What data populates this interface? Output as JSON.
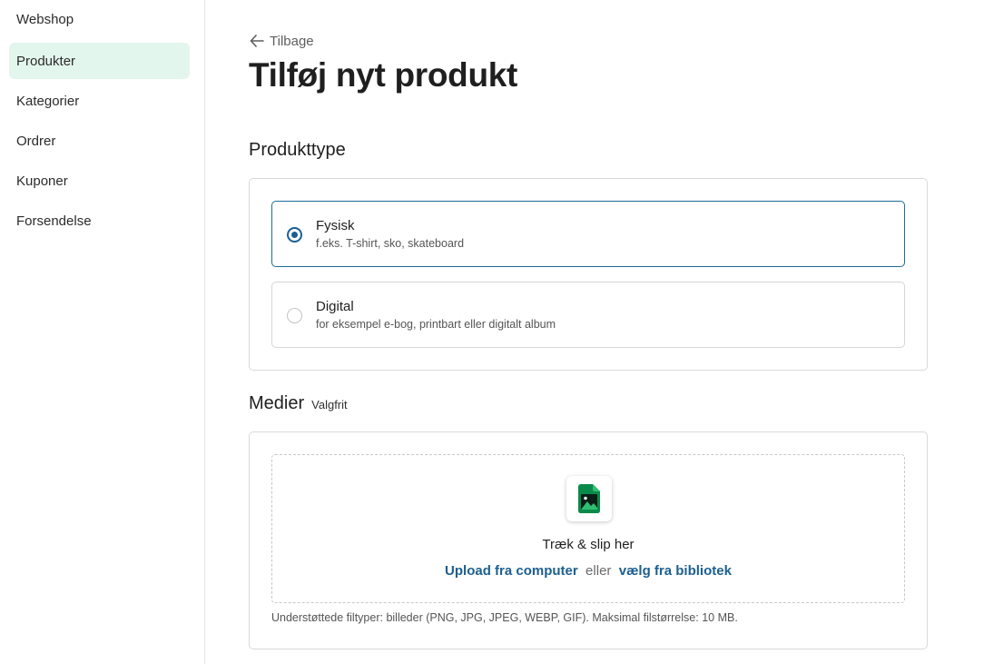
{
  "sidebar": {
    "items": [
      {
        "label": "Webshop",
        "active": false
      },
      {
        "label": "Produkter",
        "active": true
      },
      {
        "label": "Kategorier",
        "active": false
      },
      {
        "label": "Ordrer",
        "active": false
      },
      {
        "label": "Kuponer",
        "active": false
      },
      {
        "label": "Forsendelse",
        "active": false
      }
    ]
  },
  "header": {
    "back_label": "Tilbage",
    "title": "Tilføj nyt produkt"
  },
  "product_type": {
    "heading": "Produkttype",
    "options": [
      {
        "title": "Fysisk",
        "description": "f.eks. T-shirt, sko, skateboard",
        "selected": true
      },
      {
        "title": "Digital",
        "description": "for eksempel e-bog, printbart eller digitalt album",
        "selected": false
      }
    ]
  },
  "media": {
    "heading": "Medier",
    "optional_label": "Valgfrit",
    "drop_title": "Træk & slip her",
    "upload_link": "Upload fra computer",
    "or_text": "eller",
    "library_link": "vælg fra bibliotek",
    "file_types": "Understøttede filtyper: billeder (PNG, JPG, JPEG, WEBP, GIF). Maksimal filstørrelse: 10 MB.",
    "icon": "image-file-icon"
  },
  "colors": {
    "accent": "#1d5f90",
    "active_nav_bg": "#e3f6ee",
    "file_icon_green": "#0a8a4a"
  }
}
